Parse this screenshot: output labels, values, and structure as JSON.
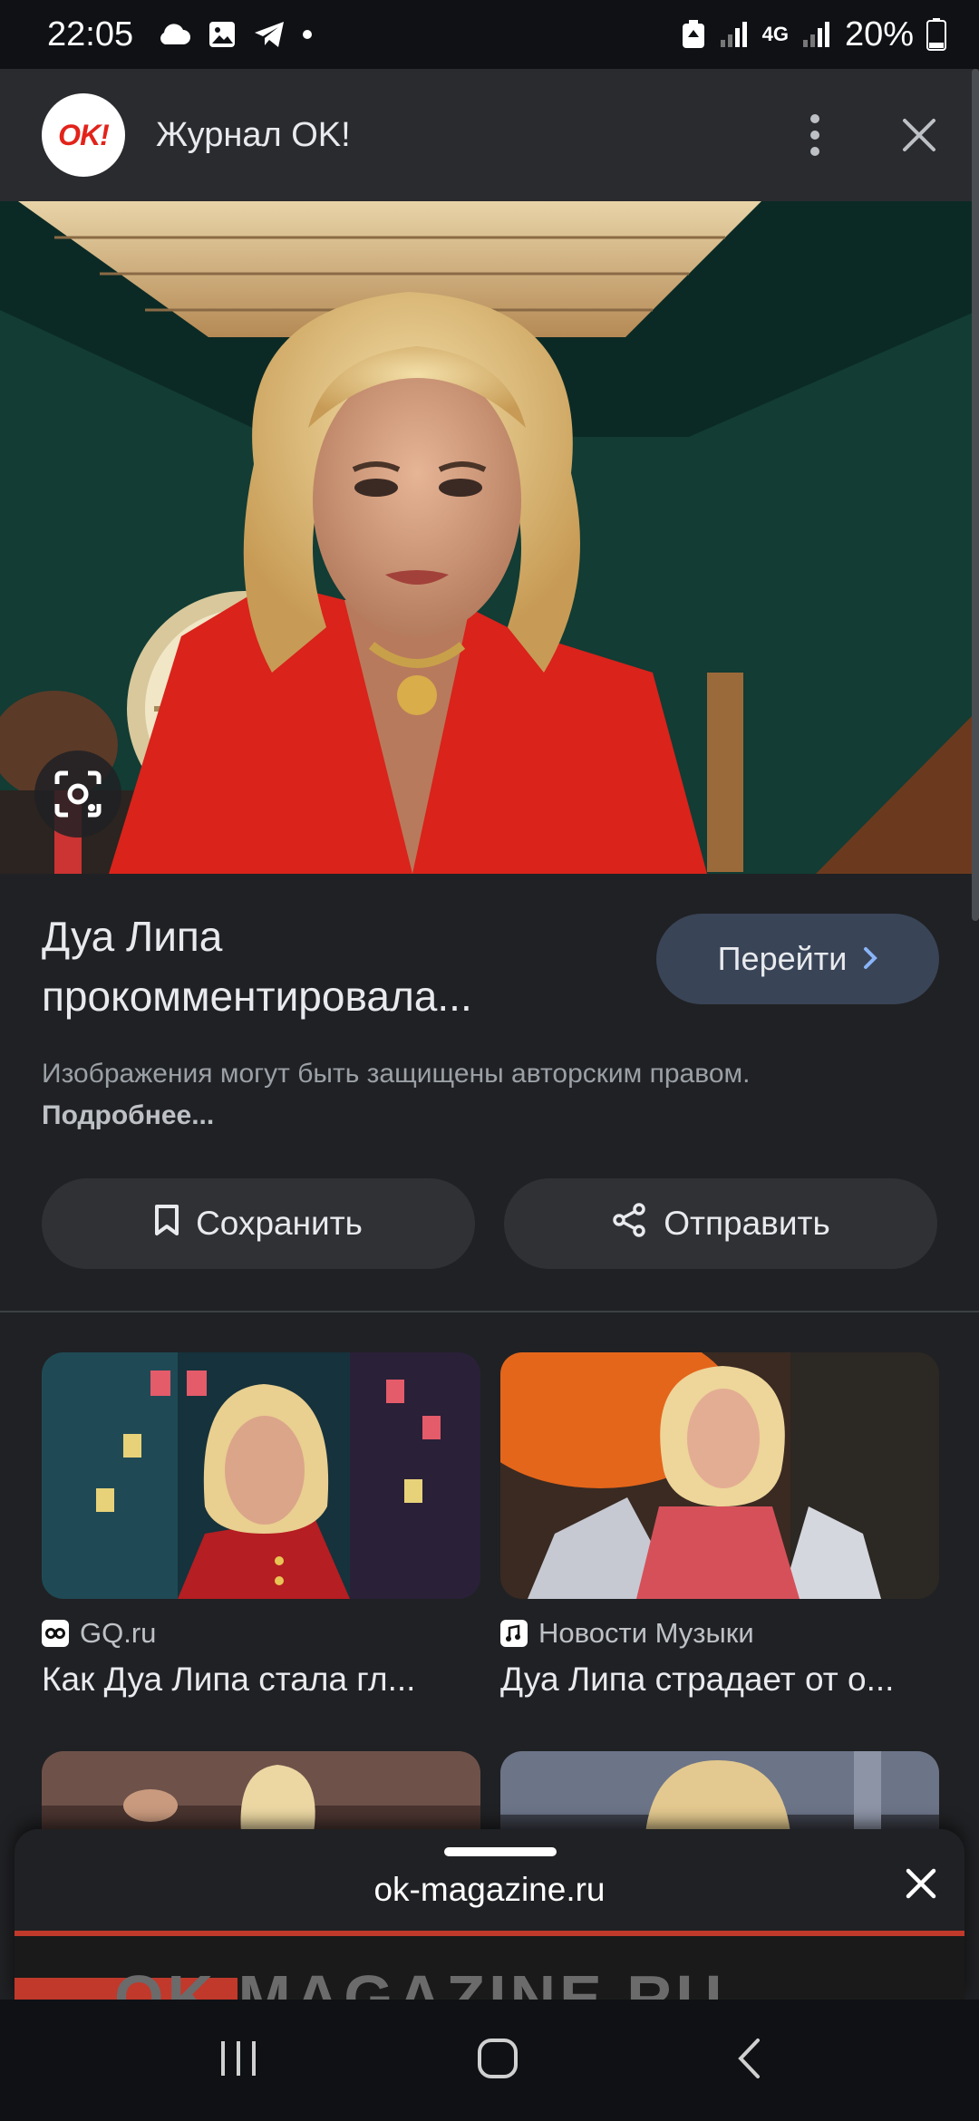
{
  "status_bar": {
    "time": "22:05",
    "battery": "20%",
    "network": "4G",
    "icons": [
      "cloud-icon",
      "image-icon",
      "telegram-icon",
      "dot-icon",
      "battery-saver-icon",
      "signal-icon",
      "battery-icon"
    ]
  },
  "header": {
    "logo_text": "OK!",
    "title": "Журнал OK!",
    "menu_icon": "more-vert-icon",
    "close_icon": "close-icon"
  },
  "hero": {
    "lens_icon": "lens-search-icon"
  },
  "result": {
    "title": "Дуа Липа прокомментировала...",
    "go_button": "Перейти",
    "notice_text": "Изображения могут быть защищены авторским правом.",
    "notice_link": "Подробнее..."
  },
  "actions": {
    "save": "Сохранить",
    "share": "Отправить"
  },
  "related": [
    {
      "source": "GQ.ru",
      "title": "Как Дуа Липа стала гл..."
    },
    {
      "source": "Новости Музыки",
      "title": "Дуа Липа страдает от о..."
    }
  ],
  "sheet": {
    "url": "ok-magazine.ru",
    "preview_text": "OK MAGAZINE.RU"
  },
  "colors": {
    "background": "#202124",
    "accent_red": "#e2231a",
    "go_button": "#394457"
  }
}
